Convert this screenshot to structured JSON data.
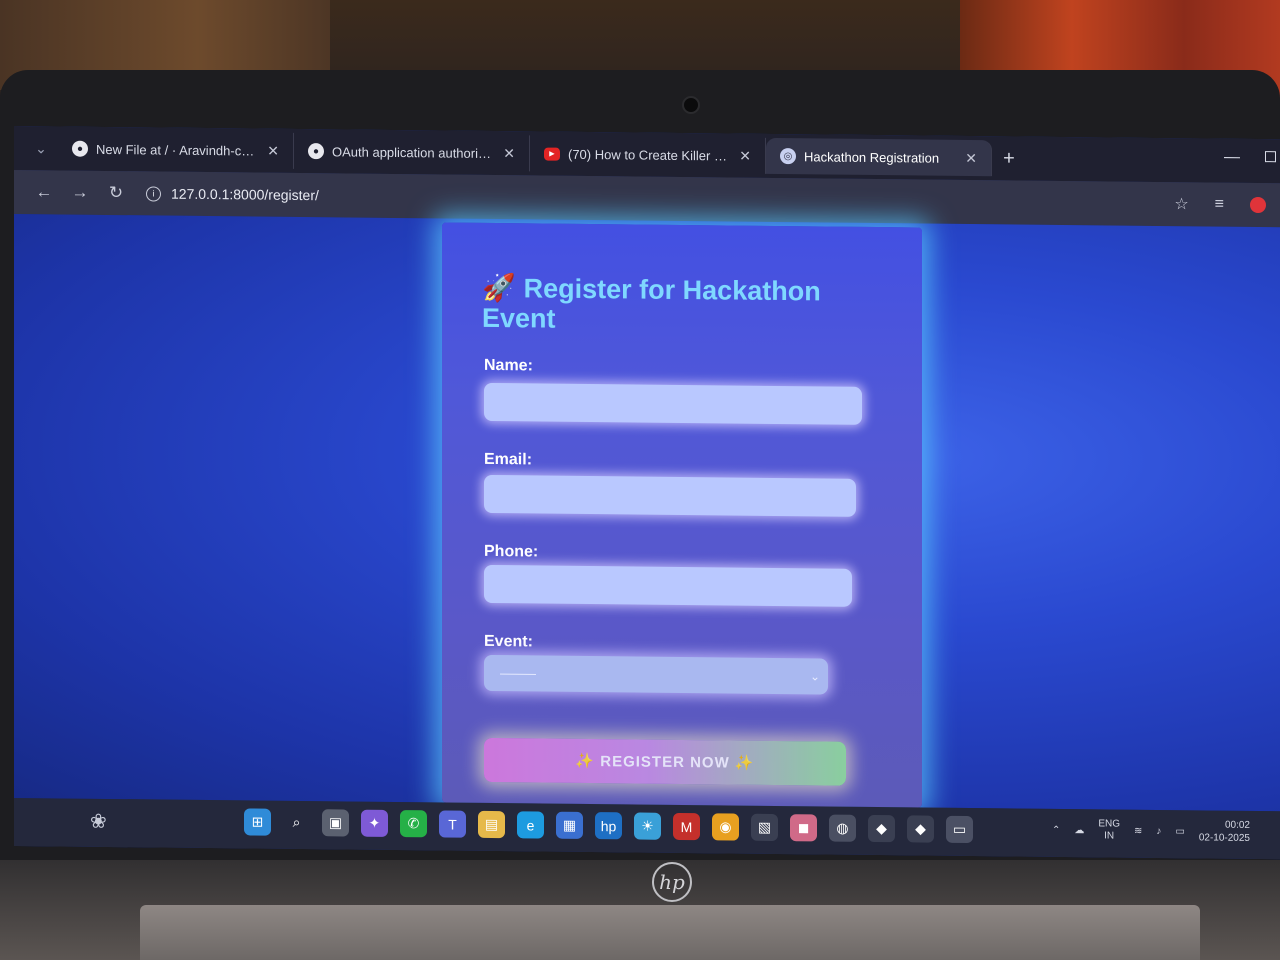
{
  "browser": {
    "tabs": [
      {
        "label": "New File at / · Aravindh-coder/",
        "icon": "github-icon"
      },
      {
        "label": "OAuth application authorized",
        "icon": "github-icon"
      },
      {
        "label": "(70) How to Create Killer GitHu",
        "icon": "youtube-icon"
      },
      {
        "label": "Hackathon Registration",
        "icon": "globe-icon",
        "active": true
      }
    ],
    "close_glyph": "✕",
    "new_tab_glyph": "+",
    "url": "127.0.0.1:8000/register/"
  },
  "page": {
    "title_icon": "🚀",
    "title": "Register for Hackathon Event",
    "fields": [
      {
        "label": "Name:",
        "value": ""
      },
      {
        "label": "Email:",
        "value": ""
      },
      {
        "label": "Phone:",
        "value": ""
      }
    ],
    "event": {
      "label": "Event:",
      "selected": "———"
    },
    "submit_label": "✨ REGISTER NOW ✨"
  },
  "taskbar": {
    "lang_top": "ENG",
    "lang_bottom": "IN",
    "time": "00:02",
    "date": "02-10-2025"
  },
  "colors": {
    "page_bg": "#2a49d0",
    "title": "#7fd8ff",
    "input_bg": "#b9c8ff",
    "button_start": "#d97be0",
    "button_end": "#8fdc9c"
  }
}
